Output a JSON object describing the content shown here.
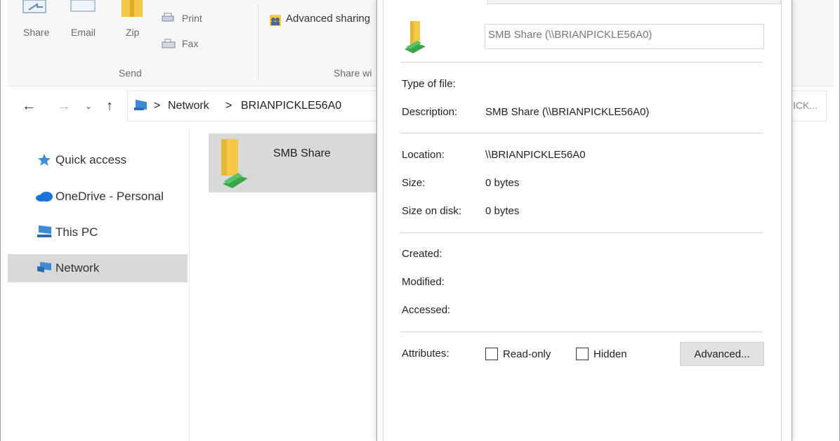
{
  "ribbon": {
    "share_label": "Share",
    "email_label": "Email",
    "zip_label": "Zip",
    "print_label": "Print",
    "fax_label": "Fax",
    "send_group_label": "Send",
    "advanced_sharing_label": "Advanced sharing",
    "share_with_group_label": "Share wi"
  },
  "address": {
    "crumbs": [
      "Network",
      "BRIANPICKLE56A0"
    ],
    "search_fragment": "ICK..."
  },
  "nav": {
    "items": [
      {
        "label": "Quick access",
        "icon": "star-icon"
      },
      {
        "label": "OneDrive - Personal",
        "icon": "cloud-icon"
      },
      {
        "label": "This PC",
        "icon": "computer-icon"
      },
      {
        "label": "Network",
        "icon": "network-icon"
      }
    ]
  },
  "files": [
    {
      "name": "SMB Share",
      "icon": "shared-folder-icon"
    }
  ],
  "dialog": {
    "name_value": "SMB Share (\\\\BRIANPICKLE56A0)",
    "type_label": "Type of file:",
    "type_value": "",
    "description_label": "Description:",
    "description_value": "SMB Share (\\\\BRIANPICKLE56A0)",
    "location_label": "Location:",
    "location_value": "\\\\BRIANPICKLE56A0",
    "size_label": "Size:",
    "size_value": "0 bytes",
    "size_on_disk_label": "Size on disk:",
    "size_on_disk_value": "0 bytes",
    "created_label": "Created:",
    "modified_label": "Modified:",
    "accessed_label": "Accessed:",
    "attributes_label": "Attributes:",
    "readonly_label": "Read-only",
    "readonly_checked": false,
    "hidden_label": "Hidden",
    "hidden_checked": false,
    "advanced_button": "Advanced..."
  },
  "colors": {
    "folder_yellow": "#f4c84a",
    "share_green": "#3aa64a",
    "star_blue": "#3b8ed8",
    "onedrive_blue": "#1a73d9",
    "selection_gray": "#d9d9d9"
  }
}
